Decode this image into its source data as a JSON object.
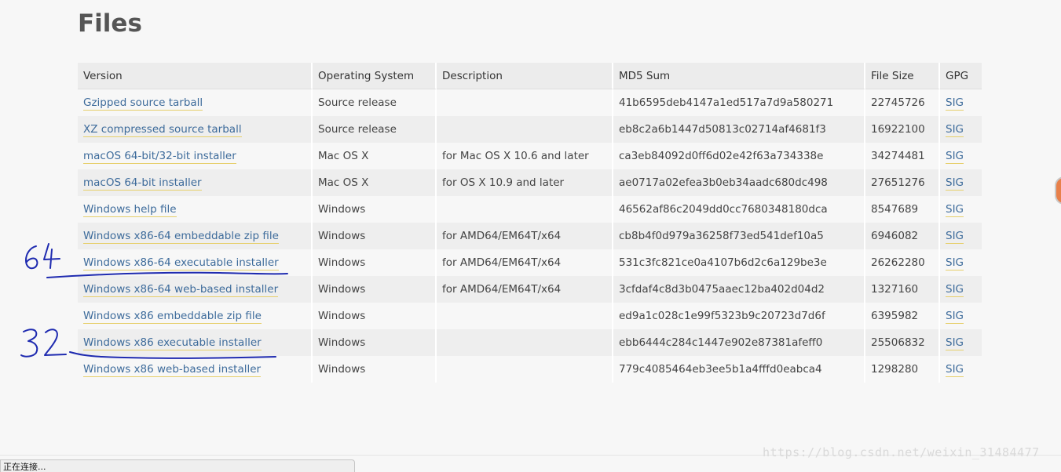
{
  "page": {
    "heading": "Files"
  },
  "table": {
    "headers": [
      "Version",
      "Operating System",
      "Description",
      "MD5 Sum",
      "File Size",
      "GPG"
    ],
    "rows": [
      {
        "version": "Gzipped source tarball",
        "os": "Source release",
        "description": "",
        "md5": "41b6595deb4147a1ed517a7d9a580271",
        "size": "22745726",
        "gpg": "SIG"
      },
      {
        "version": "XZ compressed source tarball",
        "os": "Source release",
        "description": "",
        "md5": "eb8c2a6b1447d50813c02714af4681f3",
        "size": "16922100",
        "gpg": "SIG"
      },
      {
        "version": "macOS 64-bit/32-bit installer",
        "os": "Mac OS X",
        "description": "for Mac OS X 10.6 and later",
        "md5": "ca3eb84092d0ff6d02e42f63a734338e",
        "size": "34274481",
        "gpg": "SIG"
      },
      {
        "version": "macOS 64-bit installer",
        "os": "Mac OS X",
        "description": "for OS X 10.9 and later",
        "md5": "ae0717a02efea3b0eb34aadc680dc498",
        "size": "27651276",
        "gpg": "SIG"
      },
      {
        "version": "Windows help file",
        "os": "Windows",
        "description": "",
        "md5": "46562af86c2049dd0cc7680348180dca",
        "size": "8547689",
        "gpg": "SIG"
      },
      {
        "version": "Windows x86-64 embeddable zip file",
        "os": "Windows",
        "description": "for AMD64/EM64T/x64",
        "md5": "cb8b4f0d979a36258f73ed541def10a5",
        "size": "6946082",
        "gpg": "SIG"
      },
      {
        "version": "Windows x86-64 executable installer",
        "os": "Windows",
        "description": "for AMD64/EM64T/x64",
        "md5": "531c3fc821ce0a4107b6d2c6a129be3e",
        "size": "26262280",
        "gpg": "SIG"
      },
      {
        "version": "Windows x86-64 web-based installer",
        "os": "Windows",
        "description": "for AMD64/EM64T/x64",
        "md5": "3cfdaf4c8d3b0475aaec12ba402d04d2",
        "size": "1327160",
        "gpg": "SIG"
      },
      {
        "version": "Windows x86 embeddable zip file",
        "os": "Windows",
        "description": "",
        "md5": "ed9a1c028c1e99f5323b9c20723d7d6f",
        "size": "6395982",
        "gpg": "SIG"
      },
      {
        "version": "Windows x86 executable installer",
        "os": "Windows",
        "description": "",
        "md5": "ebb6444c284c1447e902e87381afeff0",
        "size": "25506832",
        "gpg": "SIG"
      },
      {
        "version": "Windows x86 web-based installer",
        "os": "Windows",
        "description": "",
        "md5": "779c4085464eb3ee5b1a4fffd0eabca4",
        "size": "1298280",
        "gpg": "SIG"
      }
    ]
  },
  "annotations": {
    "label_64": "64",
    "label_32": "32",
    "ink_color": "#1f2bb0"
  },
  "status_bar": {
    "text": "正在连接..."
  },
  "watermark": {
    "text": "https://blog.csdn.net/weixin_31484477"
  },
  "colors": {
    "link": "#3d6b9b",
    "link_underline": "#e6cf6b",
    "header_bg": "#ececec"
  }
}
